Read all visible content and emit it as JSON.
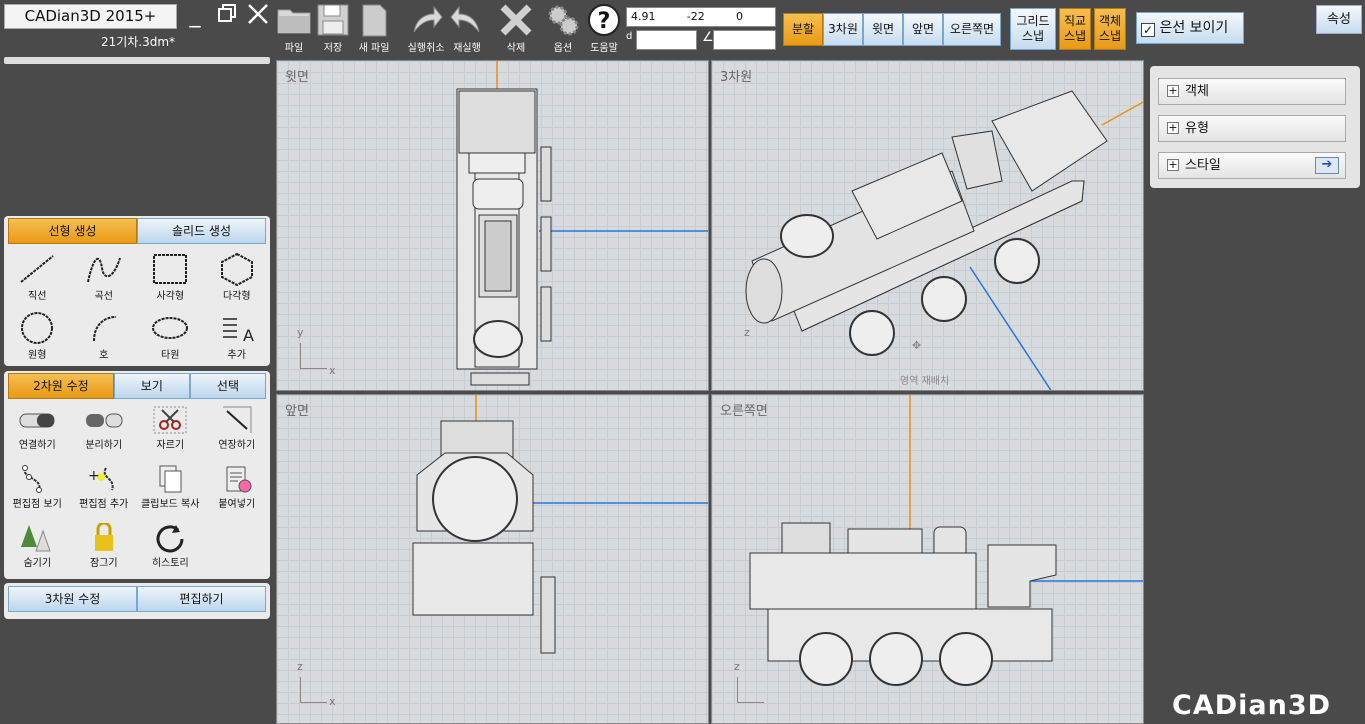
{
  "app": {
    "title": "CADian3D 2015+",
    "file": "21기차.3dm*",
    "logo": "CADian3D"
  },
  "toolbar": [
    {
      "label": "파일",
      "icon": "folder-icon"
    },
    {
      "label": "저장",
      "icon": "floppy-icon"
    },
    {
      "label": "새 파일",
      "icon": "new-file-icon"
    },
    {
      "label": "실행취소",
      "icon": "undo-icon"
    },
    {
      "label": "재실행",
      "icon": "redo-icon"
    },
    {
      "label": "삭제",
      "icon": "delete-icon"
    },
    {
      "label": "옵션",
      "icon": "gears-icon"
    },
    {
      "label": "도움말",
      "icon": "help-icon"
    }
  ],
  "coords": {
    "x": "4.91",
    "y": "-22",
    "z": "0",
    "d_label": "d",
    "d_value": "",
    "angle_label": "∠",
    "angle_value": ""
  },
  "views": {
    "split": "분할",
    "v3d": "3차원",
    "top": "윗면",
    "front": "앞면",
    "right": "오른쪽면"
  },
  "snaps": {
    "grid": [
      "그리드",
      "스냅"
    ],
    "ortho": [
      "직교",
      "스냅"
    ],
    "object": [
      "객체",
      "스냅"
    ]
  },
  "hidden_lines": "은선 보이기",
  "properties": "속성",
  "panel1": {
    "tabs": [
      "선형 생성",
      "솔리드 생성"
    ],
    "tools": [
      "직선",
      "곡선",
      "사각형",
      "다각형",
      "원형",
      "호",
      "타원",
      "추가"
    ]
  },
  "panel2": {
    "tabs": [
      "2차원 수정",
      "보기",
      "선택"
    ],
    "tools": [
      "연결하기",
      "분리하기",
      "자르기",
      "연장하기",
      "편집점 보기",
      "편집점 추가",
      "클립보드 복사",
      "붙여넣기",
      "숨기기",
      "잠그기",
      "히스토리"
    ]
  },
  "panel3": {
    "tabs": [
      "3차원 수정",
      "편집하기"
    ]
  },
  "viewports": {
    "top": "윗면",
    "v3d": "3차원",
    "front": "앞면",
    "right": "오른쪽면",
    "rearrange": "영역 재배치",
    "axis_x": "x",
    "axis_y": "y",
    "axis_z": "z"
  },
  "right_panel": [
    "객체",
    "유형",
    "스타일"
  ]
}
